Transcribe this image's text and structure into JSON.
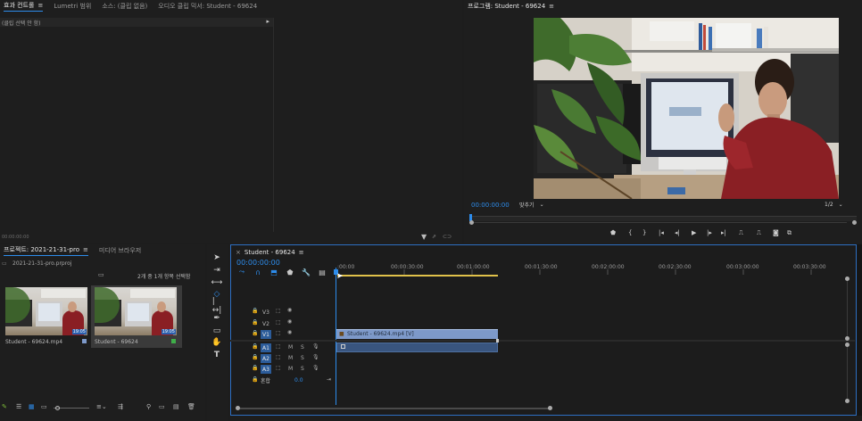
{
  "effect_controls": {
    "tabs": [
      {
        "label": "효과 컨트롤",
        "active": true
      },
      {
        "label": "Lumetri 범위",
        "active": false
      },
      {
        "label": "소스: (클립 없음)",
        "active": false
      },
      {
        "label": "오디오 클립 믹서: Student - 69624",
        "active": false
      }
    ],
    "no_clip_text": "(클립 선택 안 함)",
    "timecode": "00:00:00:00"
  },
  "program_monitor": {
    "title": "프로그램: Student - 69624",
    "timecode": "00:00:00:00",
    "fit": "맞추기",
    "quality": "1/2"
  },
  "project": {
    "tabs": [
      {
        "label": "프로젝트: 2021-21-31-pro",
        "active": true
      },
      {
        "label": "미디어 브라우저",
        "active": false
      }
    ],
    "file": "2021-21-31-pro.prproj",
    "selection_text": "2개 중 1개 항목 선택함",
    "items": [
      {
        "name": "Student - 69624.mp4",
        "badge": "19:05"
      },
      {
        "name": "Student - 69624",
        "badge": "19:05"
      }
    ]
  },
  "timeline": {
    "title": "Student - 69624",
    "timecode": "00:00:00:00",
    "ruler": [
      ":00:00",
      "00:00:30:00",
      "00:01:00:00",
      "00:01:30:00",
      "00:02:00:00",
      "00:02:30:00",
      "00:03:00:00",
      "00:03:30:00"
    ],
    "video_tracks": [
      "V3",
      "V2",
      "V1"
    ],
    "audio_tracks": [
      "A1",
      "A2",
      "A3"
    ],
    "mix_label": "혼합",
    "mix_value": "0.0",
    "clip_label": "Student - 69624.mp4 [V]",
    "track_m": "M",
    "track_s": "S"
  },
  "colors": {
    "accent": "#2d8ceb",
    "clip": "#7d99c9",
    "work_area": "#e0c14a"
  }
}
